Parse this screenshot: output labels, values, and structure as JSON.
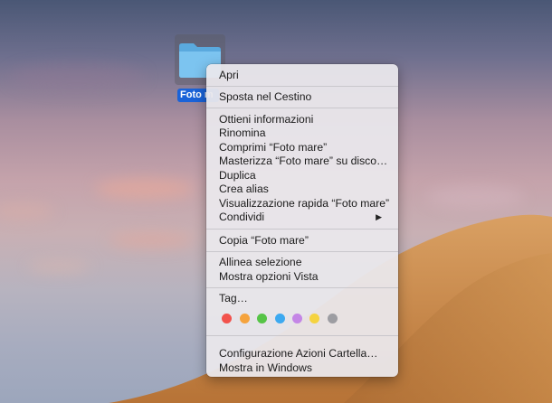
{
  "folder": {
    "name": "Foto mare",
    "shown_label": "Foto m",
    "icon": "folder-icon"
  },
  "menu": {
    "items": [
      {
        "label": "Apri"
      },
      {
        "label": "Sposta nel Cestino"
      },
      {
        "label": "Ottieni informazioni"
      },
      {
        "label": "Rinomina"
      },
      {
        "label": "Comprimi “Foto mare”"
      },
      {
        "label": "Masterizza “Foto mare” su disco…"
      },
      {
        "label": "Duplica"
      },
      {
        "label": "Crea alias"
      },
      {
        "label": "Visualizzazione rapida “Foto mare”"
      },
      {
        "label": "Condividi"
      },
      {
        "label": "Copia “Foto mare”"
      },
      {
        "label": "Allinea selezione"
      },
      {
        "label": "Mostra opzioni Vista"
      },
      {
        "label": "Tag…"
      },
      {
        "label": "Configurazione Azioni Cartella…"
      },
      {
        "label": "Mostra in Windows"
      }
    ],
    "submenu_arrow": "▶",
    "tag_colors": [
      {
        "name": "red",
        "color": "#f2524c"
      },
      {
        "name": "orange",
        "color": "#f5a33d"
      },
      {
        "name": "green",
        "color": "#56c447"
      },
      {
        "name": "blue",
        "color": "#3da9f0"
      },
      {
        "name": "purple",
        "color": "#c486e6"
      },
      {
        "name": "yellow",
        "color": "#f5d33f"
      },
      {
        "name": "gray",
        "color": "#9d9da2"
      }
    ]
  }
}
